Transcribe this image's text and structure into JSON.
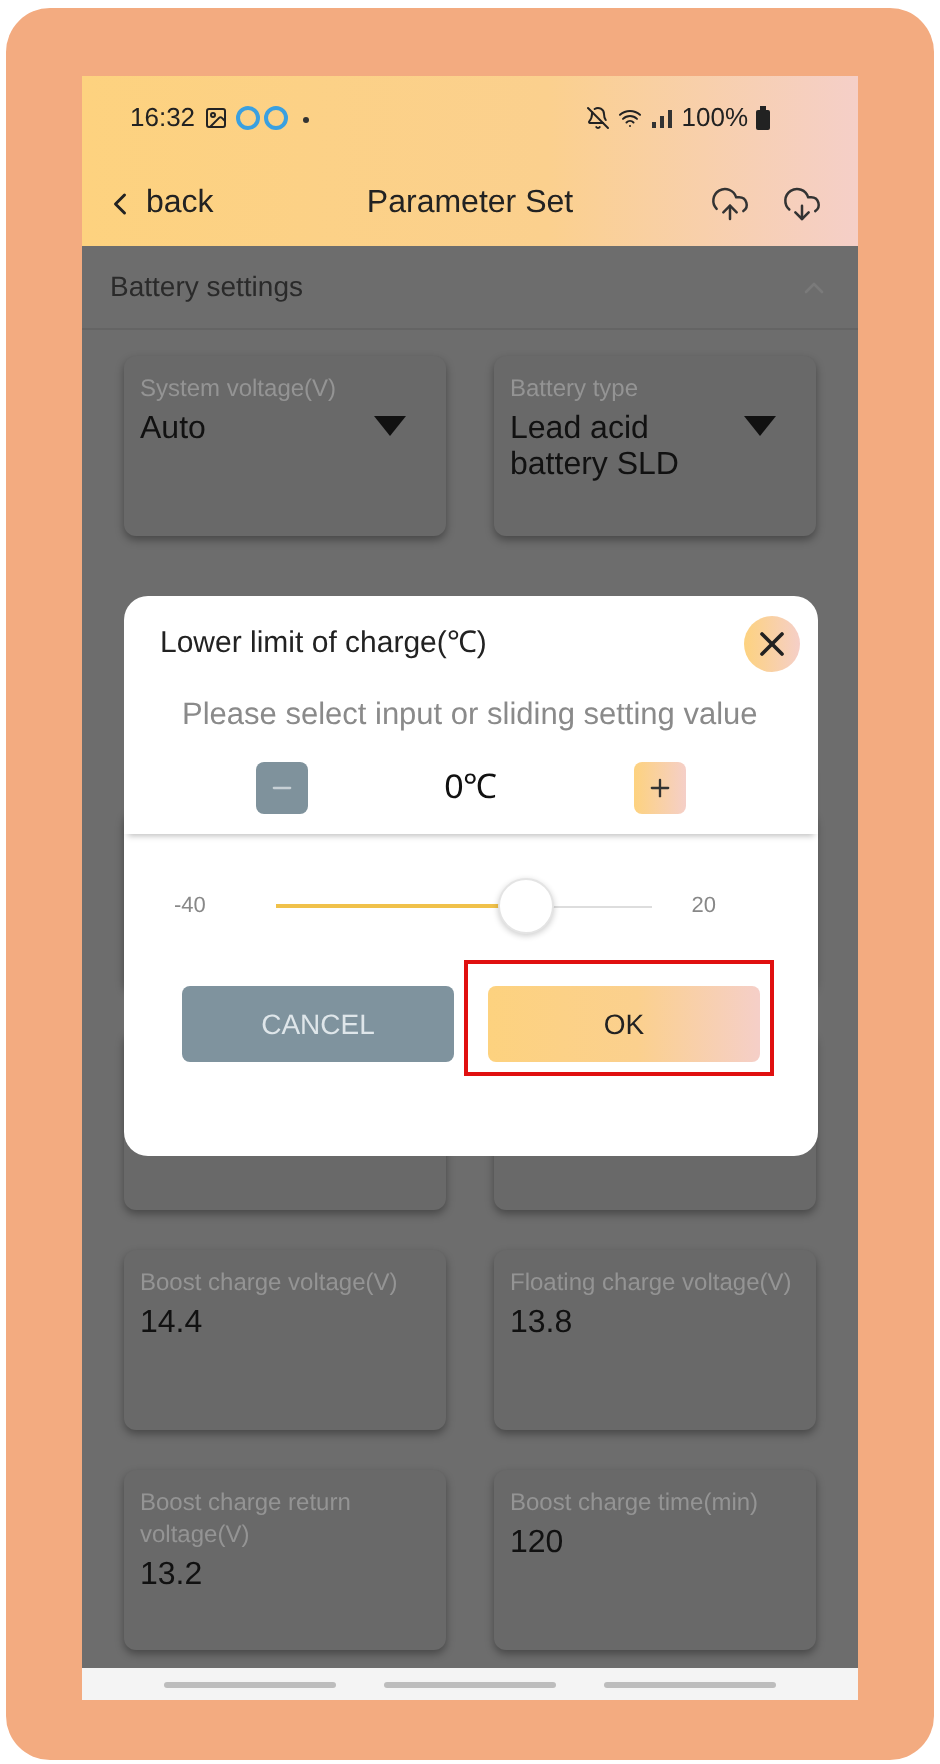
{
  "status_bar": {
    "time": "16:32",
    "battery": "100%"
  },
  "header": {
    "back": "back",
    "title": "Parameter Set"
  },
  "section": {
    "title": "Battery settings",
    "expanded": true
  },
  "top_fields": [
    {
      "label": "System voltage(V)",
      "value": "Auto",
      "dropdown": true
    },
    {
      "label": "Battery type",
      "value": "Lead acid battery SLD",
      "dropdown": true
    }
  ],
  "bottom_fields": [
    {
      "label": "Boost charge voltage(V)",
      "value": "14.4",
      "dropdown": false
    },
    {
      "label": "Floating charge voltage(V)",
      "value": "13.8",
      "dropdown": false
    },
    {
      "label": "Boost charge return voltage(V)",
      "value": "13.2",
      "dropdown": false
    },
    {
      "label": "Boost charge time(min)",
      "value": "120",
      "dropdown": false
    }
  ],
  "dialog": {
    "title": "Lower limit of charge(℃)",
    "hint": "Please select input or sliding setting value",
    "value": "0℃",
    "slider": {
      "min": "-40",
      "max": "20",
      "level": 0.667
    },
    "buttons": [
      {
        "label": "CANCEL",
        "kind": "cancel",
        "highlighted": false
      },
      {
        "label": "OK",
        "kind": "ok",
        "highlighted": true
      }
    ]
  }
}
